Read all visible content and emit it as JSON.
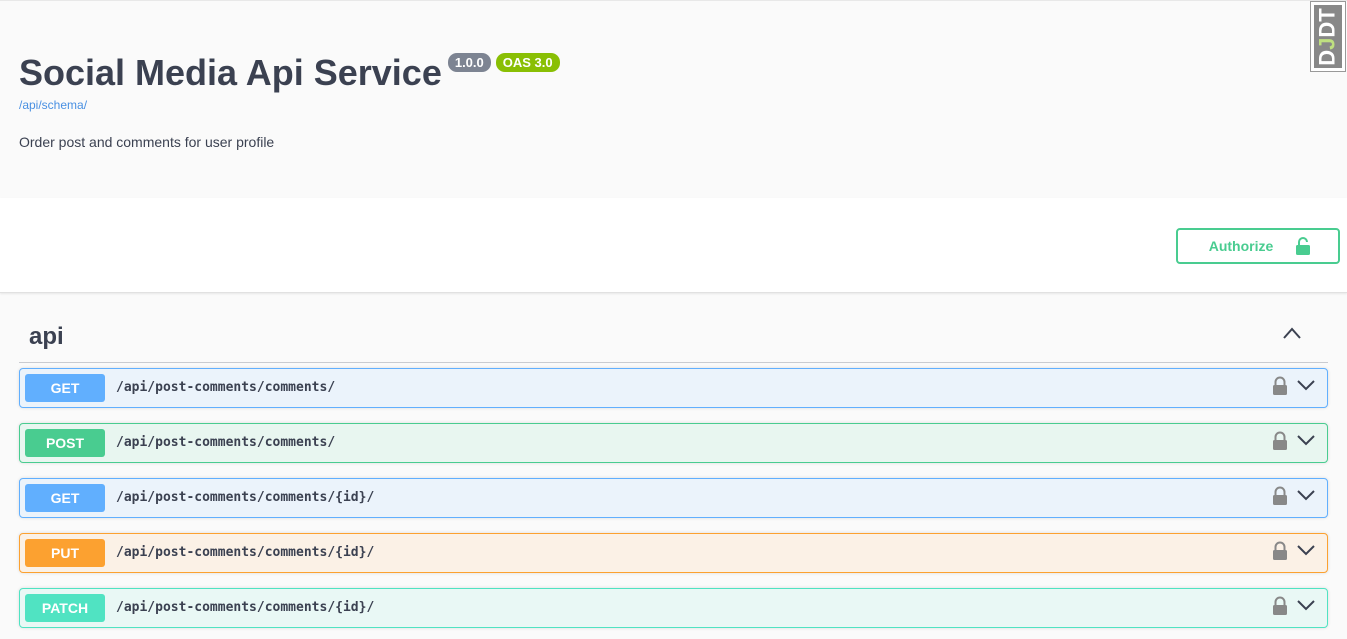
{
  "info": {
    "title": "Social Media Api Service",
    "version": "1.0.0",
    "oas": "OAS 3.0",
    "schema_link": "/api/schema/",
    "description": "Order post and comments for user profile"
  },
  "auth": {
    "button_label": "Authorize",
    "icon": "unlock-icon"
  },
  "tag": {
    "name": "api",
    "expanded": true
  },
  "operations": [
    {
      "method": "GET",
      "path": "/api/post-comments/comments/",
      "color": "#61affe"
    },
    {
      "method": "POST",
      "path": "/api/post-comments/comments/",
      "color": "#49cc90"
    },
    {
      "method": "GET",
      "path": "/api/post-comments/comments/{id}/",
      "color": "#61affe"
    },
    {
      "method": "PUT",
      "path": "/api/post-comments/comments/{id}/",
      "color": "#fca130"
    },
    {
      "method": "PATCH",
      "path": "/api/post-comments/comments/{id}/",
      "color": "#50e3c2"
    }
  ],
  "toolbar": {
    "label_start": "D",
    "label_accent": "J",
    "label_end": "DT"
  }
}
